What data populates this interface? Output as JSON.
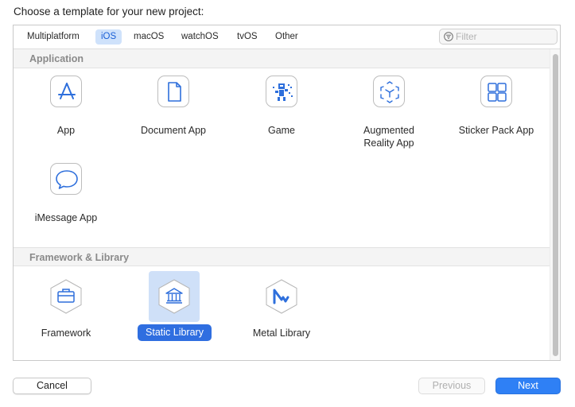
{
  "prompt": "Choose a template for your new project:",
  "tabs": [
    {
      "label": "Multiplatform"
    },
    {
      "label": "iOS"
    },
    {
      "label": "macOS"
    },
    {
      "label": "watchOS"
    },
    {
      "label": "tvOS"
    },
    {
      "label": "Other"
    }
  ],
  "active_tab": "iOS",
  "filter": {
    "placeholder": "Filter",
    "value": ""
  },
  "sections": [
    {
      "title": "Application",
      "items": [
        {
          "label": "App",
          "icon": "app-store-icon"
        },
        {
          "label": "Document App",
          "icon": "document-icon"
        },
        {
          "label": "Game",
          "icon": "game-icon"
        },
        {
          "label": "Augmented Reality App",
          "icon": "ar-cube-icon"
        },
        {
          "label": "Sticker Pack App",
          "icon": "grid-icon"
        },
        {
          "label": "iMessage App",
          "icon": "message-bubble-icon"
        }
      ]
    },
    {
      "title": "Framework & Library",
      "items": [
        {
          "label": "Framework",
          "icon": "toolbox-hexagon-icon"
        },
        {
          "label": "Static Library",
          "icon": "library-building-hexagon-icon"
        },
        {
          "label": "Metal Library",
          "icon": "metal-hexagon-icon"
        }
      ]
    }
  ],
  "selected_item": "Static Library",
  "buttons": {
    "cancel": "Cancel",
    "previous": "Previous",
    "next": "Next"
  },
  "colors": {
    "accent": "#2f80f5",
    "selection": "#cfe0f8",
    "icon_blue": "#2e6fdc"
  }
}
